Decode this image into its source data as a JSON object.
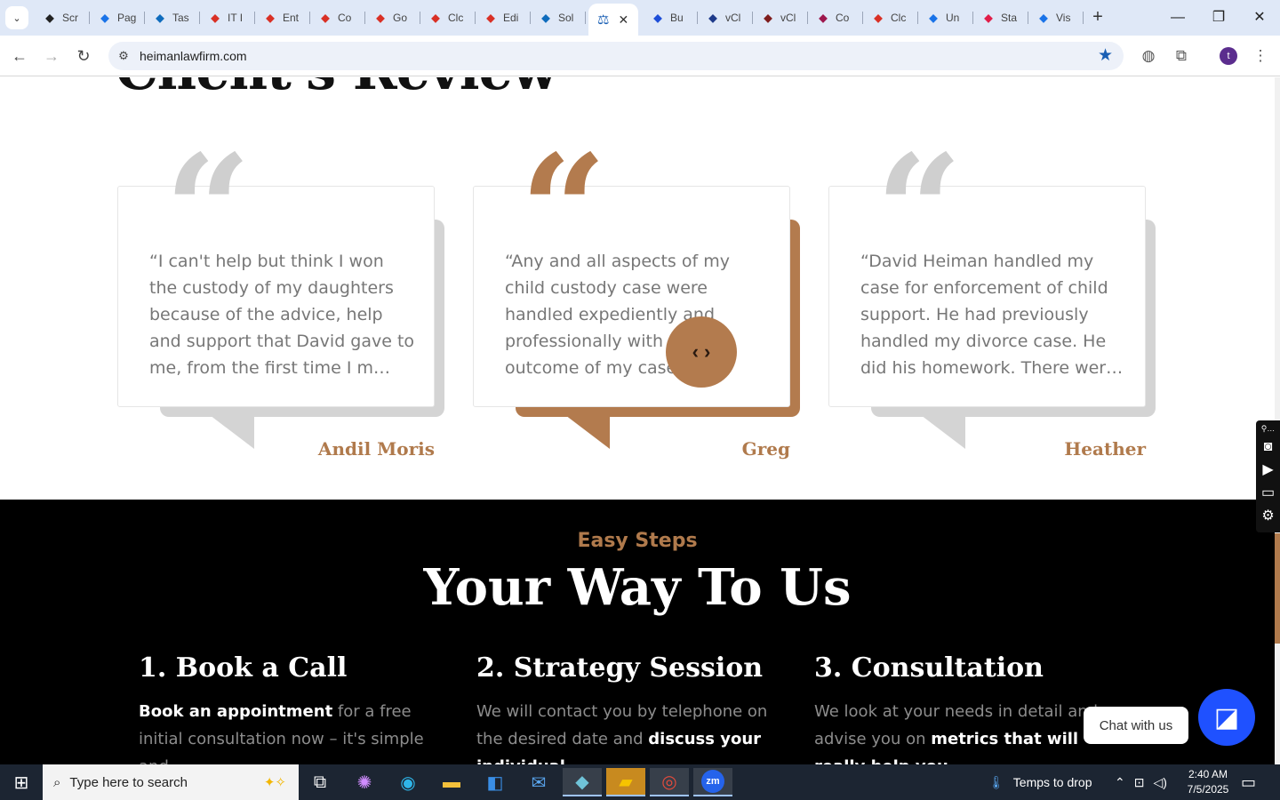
{
  "browser": {
    "tabs": [
      {
        "label": "Scr",
        "icon": "chrome-dev-icon",
        "color": "#222"
      },
      {
        "label": "Pag",
        "icon": "pagespeed-icon",
        "color": "#1a73e8"
      },
      {
        "label": "Tas",
        "icon": "tasks-icon",
        "color": "#0f6cbd"
      },
      {
        "label": "IT I",
        "icon": "diamond-red-icon",
        "color": "#d93025"
      },
      {
        "label": "Ent",
        "icon": "diamond-red-icon",
        "color": "#d93025"
      },
      {
        "label": "Co",
        "icon": "diamond-red-icon",
        "color": "#d93025"
      },
      {
        "label": "Go",
        "icon": "diamond-red-icon",
        "color": "#d93025"
      },
      {
        "label": "Clc",
        "icon": "diamond-red-icon",
        "color": "#d93025"
      },
      {
        "label": "Edi",
        "icon": "diamond-red-icon",
        "color": "#d93025"
      },
      {
        "label": "Sol",
        "icon": "tasks-icon",
        "color": "#0f6cbd"
      }
    ],
    "active_tab_icon": "scales-icon",
    "tabs_right": [
      {
        "label": "Bu",
        "icon": "x-blue-icon",
        "color": "#1d4ed8"
      },
      {
        "label": "vCl",
        "icon": "check-icon",
        "color": "#1e3a8a"
      },
      {
        "label": "vCl",
        "icon": "v-icon",
        "color": "#7f1d1d"
      },
      {
        "label": "Co",
        "icon": "circle-icon",
        "color": "#9d174d"
      },
      {
        "label": "Clc",
        "icon": "pen-icon",
        "color": "#d93025"
      },
      {
        "label": "Un",
        "icon": "doc-icon",
        "color": "#1a73e8"
      },
      {
        "label": "Sta",
        "icon": "feather-icon",
        "color": "#e11d48"
      },
      {
        "label": "Vis",
        "icon": "pulse-icon",
        "color": "#1a73e8"
      }
    ],
    "url": "heimanlawfirm.com",
    "profile_initial": "t"
  },
  "reviews": {
    "title": "Client's Review",
    "cards": [
      {
        "text": "“I can't help but think I won the custody of my daughters because of the advice, help and support that David gave to me, from the first time I m…",
        "author": "Andil Moris",
        "accent": "#d4d4d4",
        "quote_color": "#cfcfcf"
      },
      {
        "text": "“Any and all aspects of my child custody case were handled expediently and professionally with D… the outcome of my case.",
        "author": "Greg",
        "accent": "#b37b4e",
        "quote_color": "#b37b4e"
      },
      {
        "text": "“David Heiman handled my case for enforcement of child support. He had previously handled my divorce case. He did his homework. There wer…",
        "author": "Heather",
        "accent": "#d4d4d4",
        "quote_color": "#cfcfcf"
      }
    ],
    "carousel_prev": "‹",
    "carousel_next": "›"
  },
  "steps": {
    "kicker": "Easy Steps",
    "title": "Your Way To Us",
    "items": [
      {
        "heading": "1. Book a Call",
        "strong": "Book an appointment",
        "text": " for a free initial consultation now – it's simple and"
      },
      {
        "heading": "2. Strategy Session",
        "text": "We will contact you by telephone on the desired date and ",
        "strong": "discuss your individual"
      },
      {
        "heading": "3. Consultation",
        "text": "We look at your needs in detail and advise you on ",
        "strong": "metrics that will really help you."
      }
    ]
  },
  "chat": {
    "label": "Chat with us"
  },
  "taskbar": {
    "search_placeholder": "Type here to search",
    "weather": "Temps to drop",
    "time": "2:40 AM",
    "date": "7/5/2025"
  }
}
